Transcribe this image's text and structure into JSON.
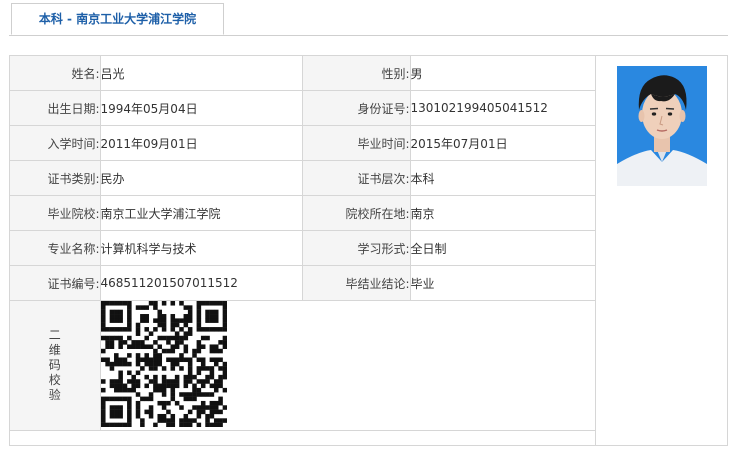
{
  "tab": {
    "label": "本科 - 南京工业大学浦江学院"
  },
  "rows": [
    {
      "label1": "姓名:",
      "value1": "吕光",
      "label2": "性别:",
      "value2": "男"
    },
    {
      "label1": "出生日期:",
      "value1": "1994年05月04日",
      "label2": "身份证号:",
      "value2": "130102199405041512"
    },
    {
      "label1": "入学时间:",
      "value1": "2011年09月01日",
      "label2": "毕业时间:",
      "value2": "2015年07月01日"
    },
    {
      "label1": "证书类别:",
      "value1": "民办",
      "label2": "证书层次:",
      "value2": "本科"
    },
    {
      "label1": "毕业院校:",
      "value1": "南京工业大学浦江学院",
      "label2": "院校所在地:",
      "value2": "南京"
    },
    {
      "label1": "专业名称:",
      "value1": "计算机科学与技术",
      "label2": "学习形式:",
      "value2": "全日制"
    },
    {
      "label1": "证书编号:",
      "value1": "468511201507011512",
      "label2": "毕结业结论:",
      "value2": "毕业"
    }
  ],
  "qr": {
    "label": "二维码校验"
  },
  "photo": {
    "background_color": "#2a88e0"
  }
}
